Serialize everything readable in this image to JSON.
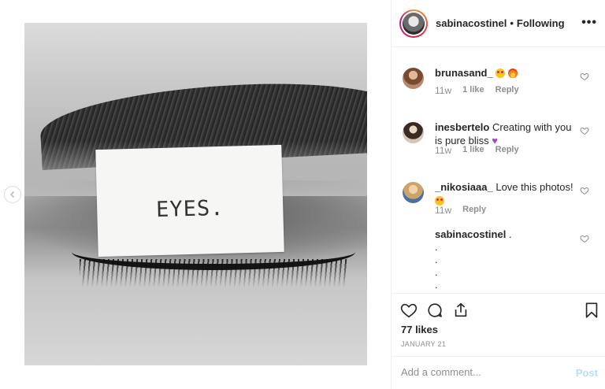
{
  "media": {
    "label_text": "EYES.",
    "prev_icon": "chevron-left-icon"
  },
  "header": {
    "username": "sabinacostinel",
    "separator": "•",
    "follow_status": "Following",
    "more_icon": "more-options-icon"
  },
  "comments": [
    {
      "username": "brunasand_",
      "text": "",
      "emoji": [
        "love-eyes",
        "fire"
      ],
      "time": "11w",
      "likes": "1 like",
      "reply": "Reply"
    },
    {
      "username": "inesbertelo",
      "text": "Creating with you is pure bliss",
      "emoji": [
        "purple-heart"
      ],
      "time": "11w",
      "likes": "1 like",
      "reply": "Reply"
    },
    {
      "username": "_nikosiaaa_",
      "text": "Love this photos!",
      "emoji": [
        "love-eyes"
      ],
      "time": "11w",
      "likes": "",
      "reply": "Reply"
    },
    {
      "username": "sabinacostinel",
      "text": ".",
      "extra_lines": [
        ".",
        ".",
        ".",
        "."
      ]
    }
  ],
  "actions": {
    "like_icon": "heart-icon",
    "comment_icon": "comment-icon",
    "share_icon": "share-icon",
    "save_icon": "bookmark-icon",
    "likes_count": "77 likes",
    "date": "JANUARY 21"
  },
  "add_comment": {
    "placeholder": "Add a comment...",
    "post_label": "Post"
  },
  "colors": {
    "text": "#262626",
    "muted": "#8e8e8e",
    "border": "#efefef",
    "post_disabled": "#b2dffc"
  }
}
